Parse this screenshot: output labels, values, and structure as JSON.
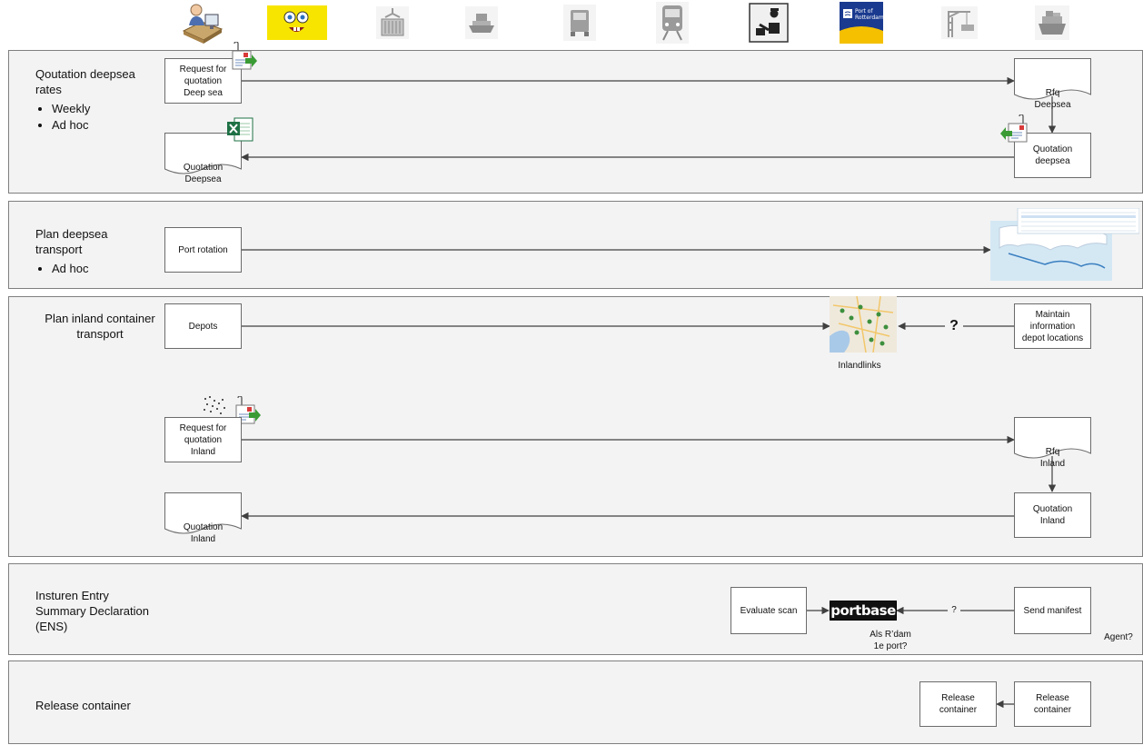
{
  "header_icons": [
    {
      "name": "office-worker-icon"
    },
    {
      "name": "sponge-character-icon"
    },
    {
      "name": "container-crane-icon"
    },
    {
      "name": "ship-icon"
    },
    {
      "name": "truck-icon"
    },
    {
      "name": "train-icon"
    },
    {
      "name": "customs-officer-icon"
    },
    {
      "name": "port-of-rotterdam-logo",
      "text": "Port of Rotterdam"
    },
    {
      "name": "terminal-crane-icon"
    },
    {
      "name": "cargo-ship-icon"
    }
  ],
  "lanes": [
    {
      "id": "deepsea-rates",
      "title": "Qoutation deepsea\nrates",
      "bullets": [
        "Weekly",
        "Ad hoc"
      ]
    },
    {
      "id": "deepsea-transport",
      "title": "Plan deepsea\ntransport",
      "bullets": [
        "Ad hoc"
      ]
    },
    {
      "id": "inland-transport",
      "title": "Plan inland container\ntransport",
      "bullets": []
    },
    {
      "id": "ens",
      "title": "Insturen Entry\nSummary Declaration\n(ENS)",
      "bullets": []
    },
    {
      "id": "release",
      "title": "Release container",
      "bullets": []
    }
  ],
  "nodes": {
    "rfq_deepsea_request": "Request for\nquotation\nDeep sea",
    "rfq_deepsea": "Rfq\nDeepsea",
    "quotation_deepsea_left": "Quotation\nDeepsea",
    "quotation_deepsea_right": "Quotation\ndeepsea",
    "port_rotation": "Port rotation",
    "depots": "Depots",
    "maintain_depots": "Maintain\ninformation\ndepot locations",
    "inlandlinks": "Inlandlinks",
    "rfq_inland_request": "Request for\nquotation\nInland",
    "rfq_inland": "Rfq\nInland",
    "quotation_inland_left": "Quotation\nInland",
    "quotation_inland_right": "Quotation\nInland",
    "evaluate_scan": "Evaluate scan",
    "portbase": "portbase",
    "send_manifest": "Send manifest",
    "als_rdam": "Als R’dam\n1e port?",
    "agent": "Agent?",
    "release_left": "Release\ncontainer",
    "release_right": "Release\ncontainer"
  },
  "edge_labels": {
    "depots_question": "?",
    "manifest_question": "?"
  },
  "colors": {
    "lane_fill": "#f3f3f3",
    "border": "#7f7f7f",
    "arrow": "#404040",
    "excel_green": "#1e7145",
    "outlook_green": "#3a9b35",
    "sponge_yellow": "#f7e500",
    "por_blue": "#1a3a8f",
    "portbase_red": "#e2231a"
  }
}
